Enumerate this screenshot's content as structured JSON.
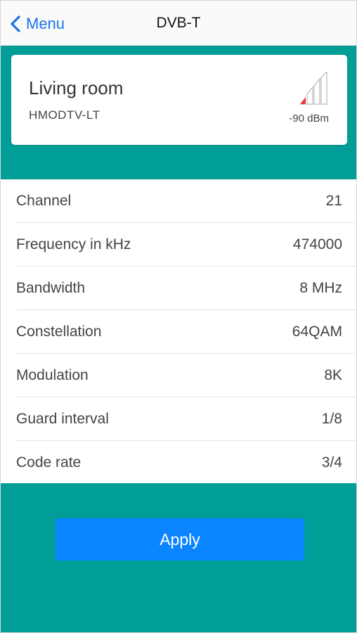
{
  "header": {
    "back_label": "Menu",
    "title": "DVB-T"
  },
  "source": {
    "name": "Living room",
    "device": "HMODTV-LT",
    "signal_dbm": "-90 dBm",
    "signal_bars_filled": 1,
    "signal_bars_total": 4,
    "signal_color": "#e53935"
  },
  "settings": [
    {
      "label": "Channel",
      "value": "21"
    },
    {
      "label": "Frequency in kHz",
      "value": "474000"
    },
    {
      "label": "Bandwidth",
      "value": "8 MHz"
    },
    {
      "label": "Constellation",
      "value": "64QAM"
    },
    {
      "label": "Modulation",
      "value": "8K"
    },
    {
      "label": "Guard interval",
      "value": "1/8"
    },
    {
      "label": "Code rate",
      "value": "3/4"
    }
  ],
  "apply_label": "Apply",
  "colors": {
    "teal": "#009e96",
    "accent_blue": "#0a84ff",
    "link_blue": "#1a73e8"
  }
}
